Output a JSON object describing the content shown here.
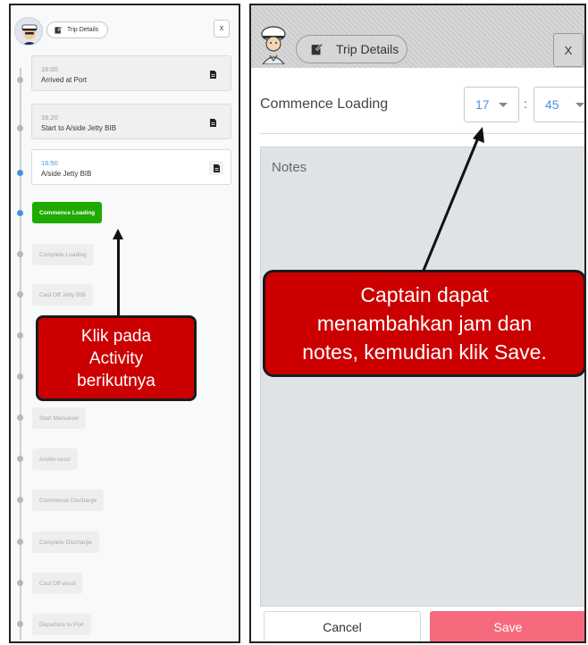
{
  "left_panel": {
    "header": {
      "trip_details_label": "Trip Details",
      "close_label": "X"
    },
    "completed_activities": [
      {
        "time": "16:00",
        "label": "Arrived at Port"
      },
      {
        "time": "16:20",
        "label": "Start to A/side Jetty BIB"
      },
      {
        "time": "16:50",
        "label": "A/side Jetty BIB"
      }
    ],
    "next_activity": "Commence Loading",
    "pending_activities": [
      "Complete Loading",
      "Cast Off Jetty BIB",
      "Start Manuever",
      "A/side vessl",
      "Commence Discharge",
      "Complete Discharge",
      "Cast Off vessl",
      "Departure to Port"
    ],
    "callout": "Klik pada\nActivity\nberikutnya"
  },
  "right_panel": {
    "header": {
      "trip_details_label": "Trip Details",
      "close_label": "X"
    },
    "form": {
      "activity_label": "Commence Loading",
      "hour_value": "17",
      "separator": ":",
      "minute_value": "45",
      "notes_placeholder": "Notes"
    },
    "buttons": {
      "cancel_label": "Cancel",
      "save_label": "Save"
    },
    "callout": "Captain dapat\nmenambahkan jam dan\nnotes, kemudian klik Save."
  },
  "colors": {
    "active_green": "#1faa00",
    "timeline_blue": "#4a90e2",
    "save_pink": "#f56b7d",
    "callout_red": "#cc0000"
  }
}
